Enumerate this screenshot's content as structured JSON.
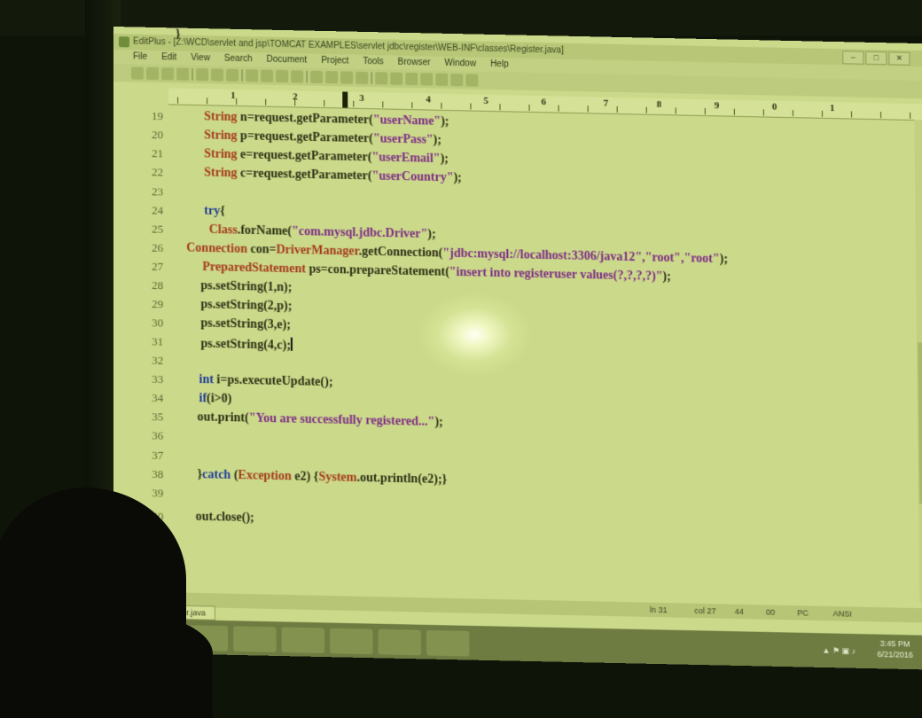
{
  "window": {
    "title": "EditPlus - [Z:\\WCD\\servlet and jsp\\TOMCAT EXAMPLES\\servlet jdbc\\register\\WEB-INF\\classes\\Register.java]",
    "controls": [
      "–",
      "□",
      "✕"
    ]
  },
  "menu": [
    "File",
    "Edit",
    "View",
    "Search",
    "Document",
    "Project",
    "Tools",
    "Browser",
    "Window",
    "Help"
  ],
  "ruler": {
    "numbers": [
      "1",
      "2",
      "3",
      "4",
      "5",
      "6",
      "7",
      "8",
      "9",
      "0",
      "1"
    ]
  },
  "editor": {
    "lines": [
      {
        "num": "19",
        "segments": [
          {
            "t": "String",
            "c": "ty"
          },
          {
            "t": " n=request.getParameter(",
            "c": ""
          },
          {
            "t": "\"userName\"",
            "c": "str"
          },
          {
            "t": ");",
            "c": ""
          }
        ]
      },
      {
        "num": "20",
        "segments": [
          {
            "t": "String",
            "c": "ty"
          },
          {
            "t": " p=request.getParameter(",
            "c": ""
          },
          {
            "t": "\"userPass\"",
            "c": "str"
          },
          {
            "t": ");",
            "c": ""
          }
        ]
      },
      {
        "num": "21",
        "segments": [
          {
            "t": "String",
            "c": "ty"
          },
          {
            "t": " e=request.getParameter(",
            "c": ""
          },
          {
            "t": "\"userEmail\"",
            "c": "str"
          },
          {
            "t": ");",
            "c": ""
          }
        ]
      },
      {
        "num": "22",
        "segments": [
          {
            "t": "String",
            "c": "ty"
          },
          {
            "t": " c=request.getParameter(",
            "c": ""
          },
          {
            "t": "\"userCountry\"",
            "c": "str"
          },
          {
            "t": ");",
            "c": ""
          }
        ]
      },
      {
        "num": "23",
        "segments": []
      },
      {
        "num": "24",
        "segments": [
          {
            "t": "try",
            "c": "kw"
          },
          {
            "t": "{",
            "c": ""
          }
        ]
      },
      {
        "num": "25",
        "segments": [
          {
            "t": " Class",
            "c": "ty"
          },
          {
            "t": ".forName(",
            "c": ""
          },
          {
            "t": "\"com.mysql.jdbc.Driver\"",
            "c": "str"
          },
          {
            "t": ");",
            "c": ""
          }
        ]
      },
      {
        "num": "26",
        "segments": [
          {
            "t": "Connection",
            "c": "ty"
          },
          {
            "t": " con=",
            "c": ""
          },
          {
            "t": "DriverManager",
            "c": "ty"
          },
          {
            "t": ".getConnection(",
            "c": ""
          },
          {
            "t": "\"jdbc:mysql://localhost:3306/java12\",\"root\",\"root\"",
            "c": "str"
          },
          {
            "t": ");",
            "c": ""
          }
        ]
      },
      {
        "num": "27",
        "segments": [
          {
            "t": "PreparedStatement",
            "c": "ty"
          },
          {
            "t": " ps=con.prepareStatement(",
            "c": ""
          },
          {
            "t": "\"insert into registeruser values(?,?,?,?)\"",
            "c": "str"
          },
          {
            "t": ");",
            "c": ""
          }
        ]
      },
      {
        "num": "28",
        "segments": [
          {
            "t": "ps.setString(1,n);",
            "c": ""
          }
        ]
      },
      {
        "num": "29",
        "segments": [
          {
            "t": "ps.setString(2,p);",
            "c": ""
          }
        ]
      },
      {
        "num": "30",
        "segments": [
          {
            "t": "ps.setString(3,e);",
            "c": ""
          }
        ]
      },
      {
        "num": "31",
        "segments": [
          {
            "t": "ps.setString(4,c);",
            "c": ""
          }
        ]
      },
      {
        "num": "32",
        "segments": []
      },
      {
        "num": "33",
        "segments": [
          {
            "t": "int",
            "c": "kw"
          },
          {
            "t": " i=ps.executeUpdate();",
            "c": ""
          }
        ]
      },
      {
        "num": "34",
        "segments": [
          {
            "t": "if",
            "c": "kw"
          },
          {
            "t": "(i>0)",
            "c": ""
          }
        ]
      },
      {
        "num": "35",
        "segments": [
          {
            "t": "out.print(",
            "c": ""
          },
          {
            "t": "\"You are successfully registered...\"",
            "c": "str"
          },
          {
            "t": ");",
            "c": ""
          }
        ]
      },
      {
        "num": "36",
        "segments": []
      },
      {
        "num": "37",
        "segments": []
      },
      {
        "num": "38",
        "segments": [
          {
            "t": "}",
            "c": ""
          },
          {
            "t": "catch",
            "c": "kw"
          },
          {
            "t": " (",
            "c": ""
          },
          {
            "t": "Exception",
            "c": "ty"
          },
          {
            "t": " e2) {",
            "c": ""
          },
          {
            "t": "System",
            "c": "ty"
          },
          {
            "t": ".out.println(e2);}",
            "c": ""
          }
        ]
      },
      {
        "num": "39",
        "segments": []
      },
      {
        "num": "40",
        "segments": [
          {
            "t": "out.close();",
            "c": ""
          }
        ]
      },
      {
        "num": "",
        "segments": [
          {
            "t": "}",
            "c": ""
          }
        ]
      }
    ]
  },
  "statusbar": {
    "ln": "ln 31",
    "col": "col 27",
    "c1": "44",
    "c2": "00",
    "mode": "PC",
    "enc": "ANSI"
  },
  "file_tab": {
    "label": "Register.java"
  },
  "taskbar": {
    "time": "3:45 PM",
    "date": "6/21/2016"
  },
  "colors": {
    "screen_bg": "#cbd98a",
    "keyword": "#1f3b9a",
    "type": "#a43a1c",
    "string": "#7d2b86"
  }
}
